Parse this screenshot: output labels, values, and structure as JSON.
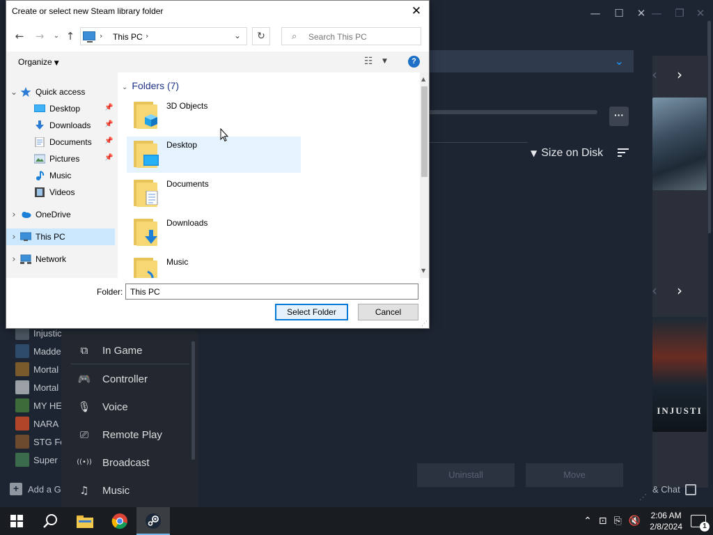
{
  "dialog": {
    "title": "Create or select new Steam library folder",
    "close_glyph": "✕",
    "address": {
      "location": "This PC",
      "separator": "›"
    },
    "search": {
      "placeholder": "Search This PC"
    },
    "commands": {
      "organize": "Organize",
      "help": "?"
    },
    "nav_tree": [
      {
        "label": "Quick access",
        "icon": "star-icon",
        "expanded": true
      },
      {
        "label": "Desktop",
        "icon": "desktop-icon",
        "pinned": true
      },
      {
        "label": "Downloads",
        "icon": "download-arrow-icon",
        "pinned": true
      },
      {
        "label": "Documents",
        "icon": "document-icon",
        "pinned": true
      },
      {
        "label": "Pictures",
        "icon": "picture-icon",
        "pinned": true
      },
      {
        "label": "Music",
        "icon": "music-note-icon"
      },
      {
        "label": "Videos",
        "icon": "film-icon"
      },
      {
        "label": "OneDrive",
        "icon": "cloud-icon"
      },
      {
        "label": "This PC",
        "icon": "computer-icon",
        "selected": true
      },
      {
        "label": "Network",
        "icon": "network-icon"
      }
    ],
    "folders_header": "Folders (7)",
    "folders": [
      {
        "name": "3D Objects",
        "overlay": "cube-icon"
      },
      {
        "name": "Desktop",
        "overlay": "desktop-icon",
        "hover": true
      },
      {
        "name": "Documents",
        "overlay": "document-icon"
      },
      {
        "name": "Downloads",
        "overlay": "download-arrow-icon"
      },
      {
        "name": "Music",
        "overlay": "music-note-icon"
      }
    ],
    "folder_field": {
      "label": "Folder:",
      "value": "This PC"
    },
    "buttons": {
      "select": "Select Folder",
      "cancel": "Cancel"
    }
  },
  "steam": {
    "sort_label": "Size on Disk",
    "buttons": {
      "uninstall": "Uninstall",
      "move": "Move"
    },
    "friends_chat": "& Chat",
    "add_game": "Add a Ga",
    "games": [
      {
        "name": "Injustic",
        "color": "#4a5560"
      },
      {
        "name": "Madde",
        "color": "#2e4a6b"
      },
      {
        "name": "Mortal",
        "color": "#7a5a2a"
      },
      {
        "name": "Mortal",
        "color": "#9aa0a6"
      },
      {
        "name": "MY HE",
        "color": "#3d6b3a"
      },
      {
        "name": "NARA",
        "color": "#b0452a"
      },
      {
        "name": "STG Fo",
        "color": "#6b4a2e"
      },
      {
        "name": "Super",
        "color": "#3a6b4a"
      }
    ],
    "settings_menu": [
      {
        "label": "In Game",
        "icon": "in-game-icon",
        "glyph": "⧉"
      },
      {
        "label": "Controller",
        "icon": "controller-icon",
        "glyph": "🎮"
      },
      {
        "label": "Voice",
        "icon": "microphone-icon",
        "glyph": "🎙"
      },
      {
        "label": "Remote Play",
        "icon": "remote-play-icon",
        "glyph": "⎚"
      },
      {
        "label": "Broadcast",
        "icon": "broadcast-icon",
        "glyph": "((•))"
      },
      {
        "label": "Music",
        "icon": "music-note-icon",
        "glyph": "♫"
      }
    ],
    "art2_caption": "INJUSTI"
  },
  "taskbar": {
    "clock_time": "2:06 AM",
    "clock_date": "2/8/2024",
    "notification_count": "1"
  },
  "colors": {
    "steam_bg": "#1e2532",
    "steam_accent": "#1a9fff",
    "dialog_select": "#cce8ff",
    "dialog_accent": "#0078d7"
  }
}
